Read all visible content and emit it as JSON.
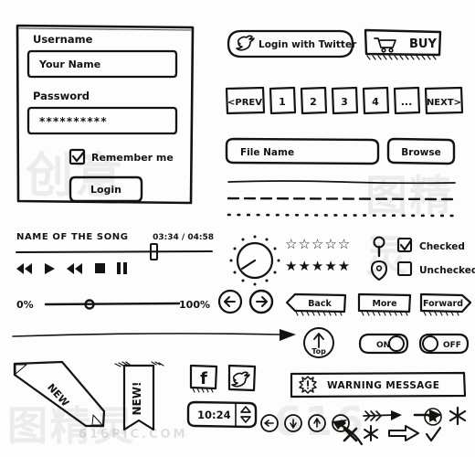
{
  "meta": {
    "kit_title": "Hand-drawn UI Wireframe Element Kit",
    "ink_color": "#15130f",
    "paper_color": "#fdfdfd"
  },
  "watermark": {
    "marks": [
      "图精灵",
      "616",
      "图精灵",
      "创意",
      "616PIC.COM"
    ]
  },
  "login_panel": {
    "name": "login-form",
    "username_label": "Username",
    "username_value": "Your Name",
    "username_placeholder": "Your Name",
    "password_label": "Password",
    "password_value": "**********",
    "password_placeholder": "**********",
    "remember_label": "Remember me",
    "remember_checked": true,
    "submit_label": "Login"
  },
  "social": {
    "twitter_login_label": "Login with Twitter",
    "twitter_icon": "twitter-bird-icon",
    "buy_label": "BUY",
    "buy_icon": "shopping-cart-icon"
  },
  "pagination": {
    "prev_label": "<PREV",
    "pages": [
      "1",
      "2",
      "3",
      "4"
    ],
    "ellipsis": "...",
    "next_label": "NEXT>"
  },
  "file_picker": {
    "field_value": "File Name",
    "field_placeholder": "File Name",
    "browse_label": "Browse"
  },
  "dividers": [
    {
      "name": "divider-solid",
      "style": "solid"
    },
    {
      "name": "divider-dashed",
      "style": "dashed"
    },
    {
      "name": "divider-dotted",
      "style": "dotted"
    }
  ],
  "media_player": {
    "track_title": "NAME OF THE SONG",
    "time_display": "03:34 / 04:58",
    "elapsed": "03:34",
    "duration": "04:58",
    "progress_percent": 70,
    "controls": [
      {
        "name": "rewind-icon",
        "glyph": "◀◀"
      },
      {
        "name": "play-icon",
        "glyph": "▶"
      },
      {
        "name": "forward-icon",
        "glyph": "▶▶"
      },
      {
        "name": "stop-icon",
        "glyph": "■"
      },
      {
        "name": "pause-icon",
        "glyph": "❙❙"
      }
    ]
  },
  "volume_slider": {
    "min_label": "0%",
    "max_label": "100%",
    "value_percent": 35
  },
  "knob": {
    "name": "rotary-knob",
    "value_percent": 20
  },
  "rating": {
    "empty_stars": 5,
    "empty_filled_count": 0,
    "filled_stars": 5,
    "filled_filled_count": 5,
    "star_glyph_empty": "☆",
    "star_glyph_full": "★"
  },
  "map_pins": [
    {
      "name": "map-pin-round-icon"
    },
    {
      "name": "map-pin-teardrop-icon"
    }
  ],
  "checkboxes": [
    {
      "name": "checkbox-checked",
      "label": "Checked",
      "checked": true
    },
    {
      "name": "checkbox-unchecked",
      "label": "Unchecked",
      "checked": false
    }
  ],
  "circle_nav": [
    {
      "name": "circle-arrow-left-button",
      "glyph": "←"
    },
    {
      "name": "circle-arrow-right-button",
      "glyph": "→"
    }
  ],
  "ribbon_buttons": [
    {
      "name": "back-button",
      "label": "Back",
      "shape": "chevron-left"
    },
    {
      "name": "more-button",
      "label": "More",
      "shape": "rect"
    },
    {
      "name": "forward-button",
      "label": "Forward",
      "shape": "chevron-right"
    }
  ],
  "long_arrow": {
    "name": "long-arrow-right"
  },
  "scroll_top": {
    "label": "Top",
    "icon": "arrow-up-icon"
  },
  "toggles": [
    {
      "name": "toggle-on",
      "label": "ON",
      "state": "on"
    },
    {
      "name": "toggle-off",
      "label": "OFF",
      "state": "off"
    }
  ],
  "ribbons": {
    "corner_label": "NEW",
    "banner_label": "NEW!"
  },
  "social_tiles": [
    {
      "name": "facebook-icon",
      "glyph": "f"
    },
    {
      "name": "twitter-icon",
      "glyph": "bird"
    }
  ],
  "stepper": {
    "value": "10:24",
    "up_icon": "chevron-up-icon",
    "down_icon": "chevron-down-icon"
  },
  "warning": {
    "icon": "warning-burst-icon",
    "message": "WARNING MESSAGE"
  },
  "circle_arrows": [
    {
      "name": "circle-arrow-left-icon",
      "glyph": "←"
    },
    {
      "name": "circle-arrow-down-icon",
      "glyph": "↓"
    },
    {
      "name": "circle-arrow-up-icon",
      "glyph": "↑"
    },
    {
      "name": "circle-arrow-right-icon",
      "glyph": "→"
    }
  ],
  "misc_marks": [
    {
      "name": "curved-arrow-left-icon"
    },
    {
      "name": "feather-arrow-right-icon"
    },
    {
      "name": "solid-arrow-right-icon"
    },
    {
      "name": "star-in-circle-icon"
    },
    {
      "name": "asterisk-icon"
    },
    {
      "name": "outline-arrow-right-icon"
    },
    {
      "name": "check-mark-icon"
    },
    {
      "name": "cross-mark-icon"
    },
    {
      "name": "small-star-icon"
    }
  ]
}
